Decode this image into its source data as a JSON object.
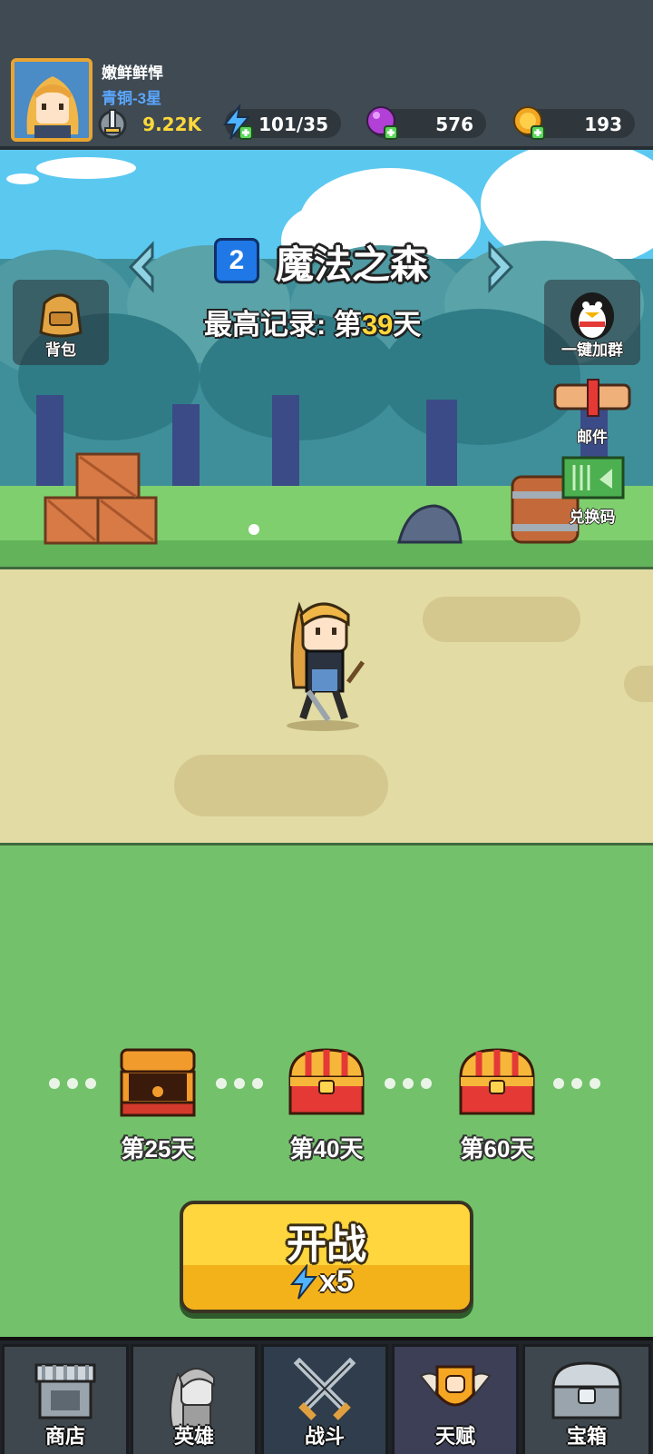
{
  "player": {
    "name": "嫩鲜鲜悍",
    "rank": "青铜-3星"
  },
  "resources": {
    "power": "9.22K",
    "energy": "101/35",
    "gems": "576",
    "coins": "193"
  },
  "stage": {
    "number": "2",
    "name": "魔法之森",
    "best_record_prefix": "最高记录: 第",
    "best_record_days": "39",
    "best_record_suffix": "天"
  },
  "side_buttons": {
    "backpack": "背包",
    "join_group": "一键加群",
    "mail": "邮件",
    "redeem_code": "兑换码"
  },
  "milestones": [
    {
      "label": "第25天",
      "state": "opened"
    },
    {
      "label": "第40天",
      "state": "closed"
    },
    {
      "label": "第60天",
      "state": "closed"
    }
  ],
  "start_button": {
    "label": "开战",
    "cost": "x5"
  },
  "nav": [
    {
      "label": "商店"
    },
    {
      "label": "英雄"
    },
    {
      "label": "战斗"
    },
    {
      "label": "天赋"
    },
    {
      "label": "宝箱"
    }
  ],
  "nav_active": "战斗",
  "colors": {
    "accent_yellow": "#ffd83a",
    "stage_badge": "#1f78e6",
    "rank_blue": "#5aa7ff"
  }
}
